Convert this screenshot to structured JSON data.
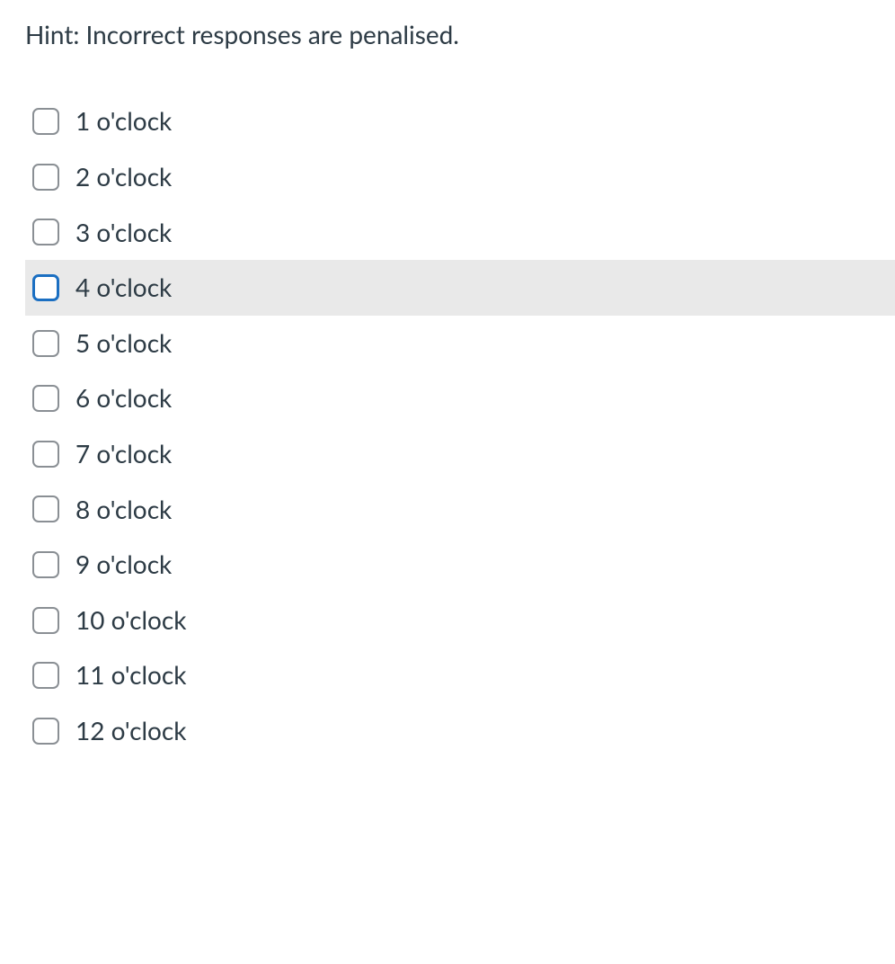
{
  "hint": "Hint: Incorrect responses are penalised.",
  "options": [
    {
      "label": "1 o'clock",
      "hovered": false
    },
    {
      "label": "2 o'clock",
      "hovered": false
    },
    {
      "label": "3 o'clock",
      "hovered": false
    },
    {
      "label": "4 o'clock",
      "hovered": true
    },
    {
      "label": "5 o'clock",
      "hovered": false
    },
    {
      "label": "6 o'clock",
      "hovered": false
    },
    {
      "label": "7 o'clock",
      "hovered": false
    },
    {
      "label": "8 o'clock",
      "hovered": false
    },
    {
      "label": "9 o'clock",
      "hovered": false
    },
    {
      "label": "10 o'clock",
      "hovered": false
    },
    {
      "label": "11 o'clock",
      "hovered": false
    },
    {
      "label": "12 o'clock",
      "hovered": false
    }
  ]
}
